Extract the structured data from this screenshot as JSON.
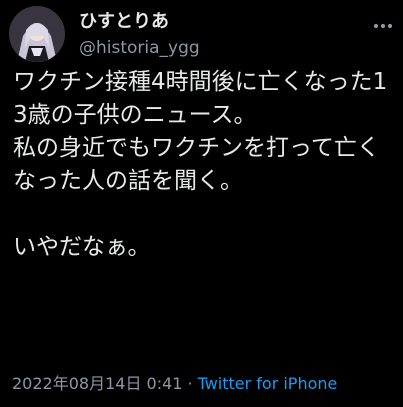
{
  "author": {
    "display_name": "ひすとりあ",
    "handle": "@historia_ygg",
    "avatar": "profile-avatar-anime-girl"
  },
  "tweet": {
    "paragraphs": [
      "ワクチン接種4時間後に亡くなった13歳の子供のニュース。",
      "私の身近でもワクチンを打って亡くなった人の話を聞く。",
      "",
      "いやだなぁ。"
    ]
  },
  "meta": {
    "timestamp": "2022年08月14日 0:41",
    "separator": "·",
    "source": "Twitter for iPhone"
  },
  "icons": {
    "more": "more-options-icon"
  },
  "colors": {
    "background": "#000000",
    "text": "#e7e9ea",
    "secondary": "#8b98a5",
    "link": "#1d9bf0"
  }
}
